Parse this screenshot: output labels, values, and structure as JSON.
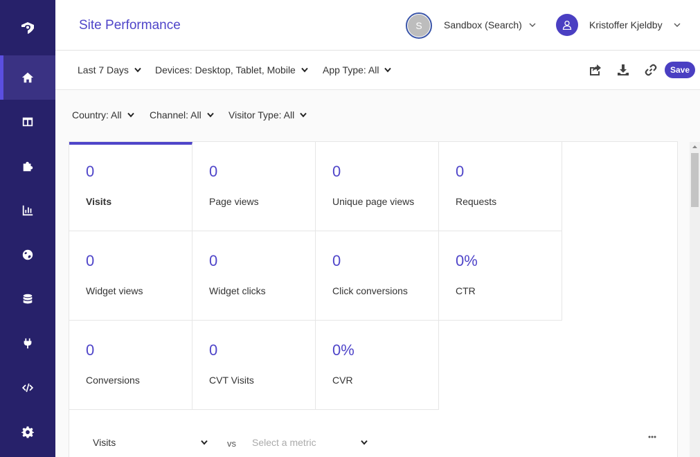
{
  "header": {
    "title": "Site Performance",
    "org_initial": "S",
    "org_name": "Sandbox (Search)",
    "user_name": "Kristoffer Kjeldby"
  },
  "sidebar": {
    "items": [
      {
        "icon": "home-icon",
        "active": true
      },
      {
        "icon": "layout-icon"
      },
      {
        "icon": "puzzle-icon"
      },
      {
        "icon": "bar-chart-icon"
      },
      {
        "icon": "globe-icon"
      },
      {
        "icon": "database-icon"
      },
      {
        "icon": "plug-icon"
      },
      {
        "icon": "code-icon"
      },
      {
        "icon": "gear-icon"
      }
    ]
  },
  "toolbar": {
    "date_range": "Last 7 Days",
    "devices": "Devices: Desktop, Tablet, Mobile",
    "app_type": "App Type: All",
    "save_label": "Save",
    "icons": [
      "share-icon",
      "download-icon",
      "link-icon"
    ]
  },
  "filters": {
    "country": "Country: All",
    "channel": "Channel: All",
    "visitor_type": "Visitor Type: All"
  },
  "metrics": [
    {
      "value": "0",
      "label": "Visits"
    },
    {
      "value": "0",
      "label": "Page views"
    },
    {
      "value": "0",
      "label": "Unique page views"
    },
    {
      "value": "0",
      "label": "Requests"
    },
    {
      "value": "0",
      "label": "Widget views"
    },
    {
      "value": "0",
      "label": "Widget clicks"
    },
    {
      "value": "0",
      "label": "Click conversions"
    },
    {
      "value": "0%",
      "label": "CTR"
    },
    {
      "value": "0",
      "label": "Conversions"
    },
    {
      "value": "0",
      "label": "CVT Visits"
    },
    {
      "value": "0%",
      "label": "CVR"
    }
  ],
  "comparison": {
    "primary": "Visits",
    "vs": "vs",
    "secondary_placeholder": "Select a metric"
  },
  "colors": {
    "sidebar": "#27216a",
    "accent": "#4f45c9",
    "save_button": "#4a3fc2"
  }
}
